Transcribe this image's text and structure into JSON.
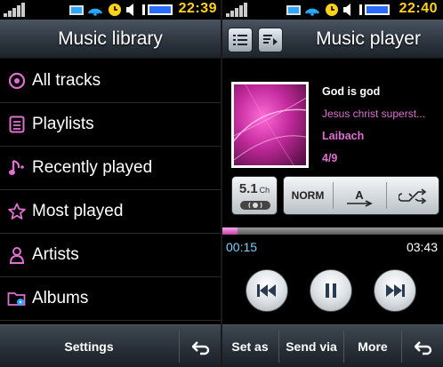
{
  "left": {
    "status_time": "22:39",
    "header_title": "Music library",
    "items": [
      {
        "label": "All tracks",
        "icon": "disc-icon"
      },
      {
        "label": "Playlists",
        "icon": "playlist-icon"
      },
      {
        "label": "Recently played",
        "icon": "music-note-icon"
      },
      {
        "label": "Most played",
        "icon": "star-icon"
      },
      {
        "label": "Artists",
        "icon": "person-icon"
      },
      {
        "label": "Albums",
        "icon": "album-folder-icon"
      }
    ],
    "bottom": {
      "settings_label": "Settings",
      "back_icon": "back-arrow-icon"
    }
  },
  "right": {
    "status_time": "22:40",
    "header_title": "Music player",
    "song": {
      "title": "God is god",
      "album": "Jesus christ superst...",
      "artist": "Laibach",
      "track": "4/9"
    },
    "controls": {
      "surround_label": "5.1",
      "surround_sub": "Ch",
      "eq_label": "NORM",
      "repeat_label": "A",
      "shuffle_icon": "shuffle-icon"
    },
    "progress": {
      "elapsed": "00:15",
      "total": "03:43",
      "fraction": 0.067
    },
    "bottom": {
      "set_as_label": "Set as",
      "send_via_label": "Send via",
      "more_label": "More",
      "back_icon": "back-arrow-icon"
    }
  },
  "colors": {
    "accent_pink": "#e070d0",
    "time_yellow": "#ffd21a",
    "elapsed_blue": "#7bd0ff"
  }
}
